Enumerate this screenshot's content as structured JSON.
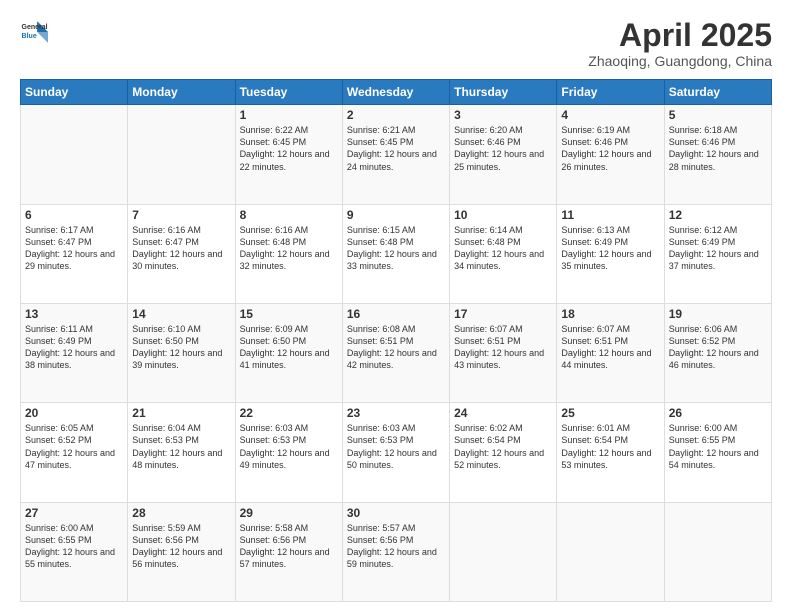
{
  "header": {
    "logo_line1": "General",
    "logo_line2": "Blue",
    "month_title": "April 2025",
    "location": "Zhaoqing, Guangdong, China"
  },
  "days_of_week": [
    "Sunday",
    "Monday",
    "Tuesday",
    "Wednesday",
    "Thursday",
    "Friday",
    "Saturday"
  ],
  "weeks": [
    [
      {
        "day": "",
        "sunrise": "",
        "sunset": "",
        "daylight": ""
      },
      {
        "day": "",
        "sunrise": "",
        "sunset": "",
        "daylight": ""
      },
      {
        "day": "1",
        "sunrise": "Sunrise: 6:22 AM",
        "sunset": "Sunset: 6:45 PM",
        "daylight": "Daylight: 12 hours and 22 minutes."
      },
      {
        "day": "2",
        "sunrise": "Sunrise: 6:21 AM",
        "sunset": "Sunset: 6:45 PM",
        "daylight": "Daylight: 12 hours and 24 minutes."
      },
      {
        "day": "3",
        "sunrise": "Sunrise: 6:20 AM",
        "sunset": "Sunset: 6:46 PM",
        "daylight": "Daylight: 12 hours and 25 minutes."
      },
      {
        "day": "4",
        "sunrise": "Sunrise: 6:19 AM",
        "sunset": "Sunset: 6:46 PM",
        "daylight": "Daylight: 12 hours and 26 minutes."
      },
      {
        "day": "5",
        "sunrise": "Sunrise: 6:18 AM",
        "sunset": "Sunset: 6:46 PM",
        "daylight": "Daylight: 12 hours and 28 minutes."
      }
    ],
    [
      {
        "day": "6",
        "sunrise": "Sunrise: 6:17 AM",
        "sunset": "Sunset: 6:47 PM",
        "daylight": "Daylight: 12 hours and 29 minutes."
      },
      {
        "day": "7",
        "sunrise": "Sunrise: 6:16 AM",
        "sunset": "Sunset: 6:47 PM",
        "daylight": "Daylight: 12 hours and 30 minutes."
      },
      {
        "day": "8",
        "sunrise": "Sunrise: 6:16 AM",
        "sunset": "Sunset: 6:48 PM",
        "daylight": "Daylight: 12 hours and 32 minutes."
      },
      {
        "day": "9",
        "sunrise": "Sunrise: 6:15 AM",
        "sunset": "Sunset: 6:48 PM",
        "daylight": "Daylight: 12 hours and 33 minutes."
      },
      {
        "day": "10",
        "sunrise": "Sunrise: 6:14 AM",
        "sunset": "Sunset: 6:48 PM",
        "daylight": "Daylight: 12 hours and 34 minutes."
      },
      {
        "day": "11",
        "sunrise": "Sunrise: 6:13 AM",
        "sunset": "Sunset: 6:49 PM",
        "daylight": "Daylight: 12 hours and 35 minutes."
      },
      {
        "day": "12",
        "sunrise": "Sunrise: 6:12 AM",
        "sunset": "Sunset: 6:49 PM",
        "daylight": "Daylight: 12 hours and 37 minutes."
      }
    ],
    [
      {
        "day": "13",
        "sunrise": "Sunrise: 6:11 AM",
        "sunset": "Sunset: 6:49 PM",
        "daylight": "Daylight: 12 hours and 38 minutes."
      },
      {
        "day": "14",
        "sunrise": "Sunrise: 6:10 AM",
        "sunset": "Sunset: 6:50 PM",
        "daylight": "Daylight: 12 hours and 39 minutes."
      },
      {
        "day": "15",
        "sunrise": "Sunrise: 6:09 AM",
        "sunset": "Sunset: 6:50 PM",
        "daylight": "Daylight: 12 hours and 41 minutes."
      },
      {
        "day": "16",
        "sunrise": "Sunrise: 6:08 AM",
        "sunset": "Sunset: 6:51 PM",
        "daylight": "Daylight: 12 hours and 42 minutes."
      },
      {
        "day": "17",
        "sunrise": "Sunrise: 6:07 AM",
        "sunset": "Sunset: 6:51 PM",
        "daylight": "Daylight: 12 hours and 43 minutes."
      },
      {
        "day": "18",
        "sunrise": "Sunrise: 6:07 AM",
        "sunset": "Sunset: 6:51 PM",
        "daylight": "Daylight: 12 hours and 44 minutes."
      },
      {
        "day": "19",
        "sunrise": "Sunrise: 6:06 AM",
        "sunset": "Sunset: 6:52 PM",
        "daylight": "Daylight: 12 hours and 46 minutes."
      }
    ],
    [
      {
        "day": "20",
        "sunrise": "Sunrise: 6:05 AM",
        "sunset": "Sunset: 6:52 PM",
        "daylight": "Daylight: 12 hours and 47 minutes."
      },
      {
        "day": "21",
        "sunrise": "Sunrise: 6:04 AM",
        "sunset": "Sunset: 6:53 PM",
        "daylight": "Daylight: 12 hours and 48 minutes."
      },
      {
        "day": "22",
        "sunrise": "Sunrise: 6:03 AM",
        "sunset": "Sunset: 6:53 PM",
        "daylight": "Daylight: 12 hours and 49 minutes."
      },
      {
        "day": "23",
        "sunrise": "Sunrise: 6:03 AM",
        "sunset": "Sunset: 6:53 PM",
        "daylight": "Daylight: 12 hours and 50 minutes."
      },
      {
        "day": "24",
        "sunrise": "Sunrise: 6:02 AM",
        "sunset": "Sunset: 6:54 PM",
        "daylight": "Daylight: 12 hours and 52 minutes."
      },
      {
        "day": "25",
        "sunrise": "Sunrise: 6:01 AM",
        "sunset": "Sunset: 6:54 PM",
        "daylight": "Daylight: 12 hours and 53 minutes."
      },
      {
        "day": "26",
        "sunrise": "Sunrise: 6:00 AM",
        "sunset": "Sunset: 6:55 PM",
        "daylight": "Daylight: 12 hours and 54 minutes."
      }
    ],
    [
      {
        "day": "27",
        "sunrise": "Sunrise: 6:00 AM",
        "sunset": "Sunset: 6:55 PM",
        "daylight": "Daylight: 12 hours and 55 minutes."
      },
      {
        "day": "28",
        "sunrise": "Sunrise: 5:59 AM",
        "sunset": "Sunset: 6:56 PM",
        "daylight": "Daylight: 12 hours and 56 minutes."
      },
      {
        "day": "29",
        "sunrise": "Sunrise: 5:58 AM",
        "sunset": "Sunset: 6:56 PM",
        "daylight": "Daylight: 12 hours and 57 minutes."
      },
      {
        "day": "30",
        "sunrise": "Sunrise: 5:57 AM",
        "sunset": "Sunset: 6:56 PM",
        "daylight": "Daylight: 12 hours and 59 minutes."
      },
      {
        "day": "",
        "sunrise": "",
        "sunset": "",
        "daylight": ""
      },
      {
        "day": "",
        "sunrise": "",
        "sunset": "",
        "daylight": ""
      },
      {
        "day": "",
        "sunrise": "",
        "sunset": "",
        "daylight": ""
      }
    ]
  ]
}
